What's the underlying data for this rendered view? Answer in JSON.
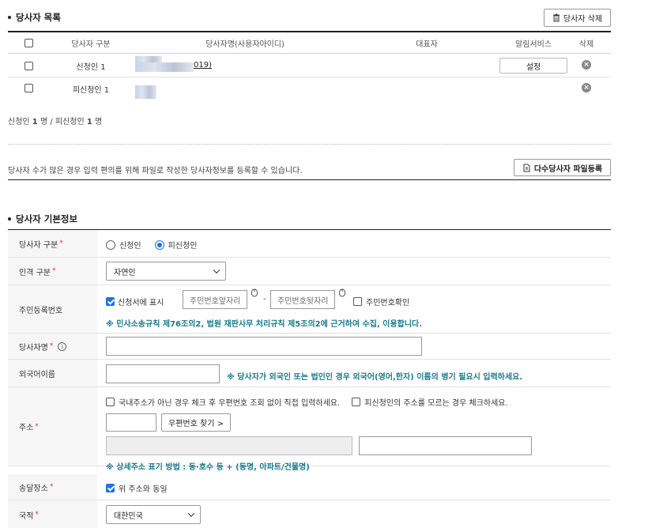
{
  "party_list": {
    "title": "당사자 목록",
    "delete_button": "당사자 삭제",
    "columns": [
      "당사자 구분",
      "당사자명(사용자아이디)",
      "대표자",
      "알림서비스",
      "삭제"
    ],
    "rows": [
      {
        "type": "신청인 1",
        "name_suffix": "019)",
        "setting_button": "설정"
      },
      {
        "type": "피신청인 1"
      }
    ],
    "summary_prefix1": "신청인",
    "summary_count1": "1",
    "summary_unit1": "명 / 피신청인",
    "summary_count2": "1",
    "summary_unit2": "명",
    "bulk_text": "당사자 수가 많은 경우 입력 편의를 위해 파일로 작성한 당사자정보를 등록할 수 있습니다.",
    "bulk_button": "다수당사자 파일등록"
  },
  "basic_info": {
    "title": "당사자 기본정보",
    "type_label": "당사자 구분",
    "radio_applicant": "신청인",
    "radio_respondent": "피신청인",
    "person_type_label": "인격 구분",
    "person_type_value": "자연인",
    "rrn_label": "주민등록번호",
    "rrn_show_label": "신청서에 표시",
    "rrn_front_placeholder": "주민번호앞자리",
    "rrn_dash": "-",
    "rrn_back_placeholder": "주민번호뒷자리",
    "rrn_confirm_label": "주민번호확인",
    "rrn_note": "※ 민사소송규칙 제76조의2, 법원 재판사무 처리규칙 제5조의2에 근거하여 수집, 이용합니다.",
    "name_label": "당사자명",
    "foreign_name_label": "외국어이름",
    "foreign_name_note": "※ 당사자가 외국인 또는 법인인 경우 외국어(영어,한자) 이름의 병기 필요시 입력하세요.",
    "address_label": "주소",
    "address_check1": "국내주소가 아닌 경우 체크 후 우편번호 조회 없이 직접 입력하세요.",
    "address_check2": "피신청인의 주소를 모르는 경우 체크하세요.",
    "zip_button": "우편번호 찾기 >",
    "address_note": "※ 상세주소 표기 방법 : 동·호수 등 + (동명, 아파트/건물명)",
    "delivery_label": "송달장소",
    "delivery_same_label": "위 주소와 동일",
    "nationality_label": "국적",
    "nationality_value": "대한민국"
  },
  "icons": {
    "trash": "trash-icon",
    "file": "file-register-icon",
    "info": "info-icon",
    "mouse": "mouse-keyboard-icon",
    "close": "close-circle-icon"
  },
  "colors": {
    "accent": "#1a73e8",
    "note": "#1a7a8c",
    "required": "#e03030"
  }
}
